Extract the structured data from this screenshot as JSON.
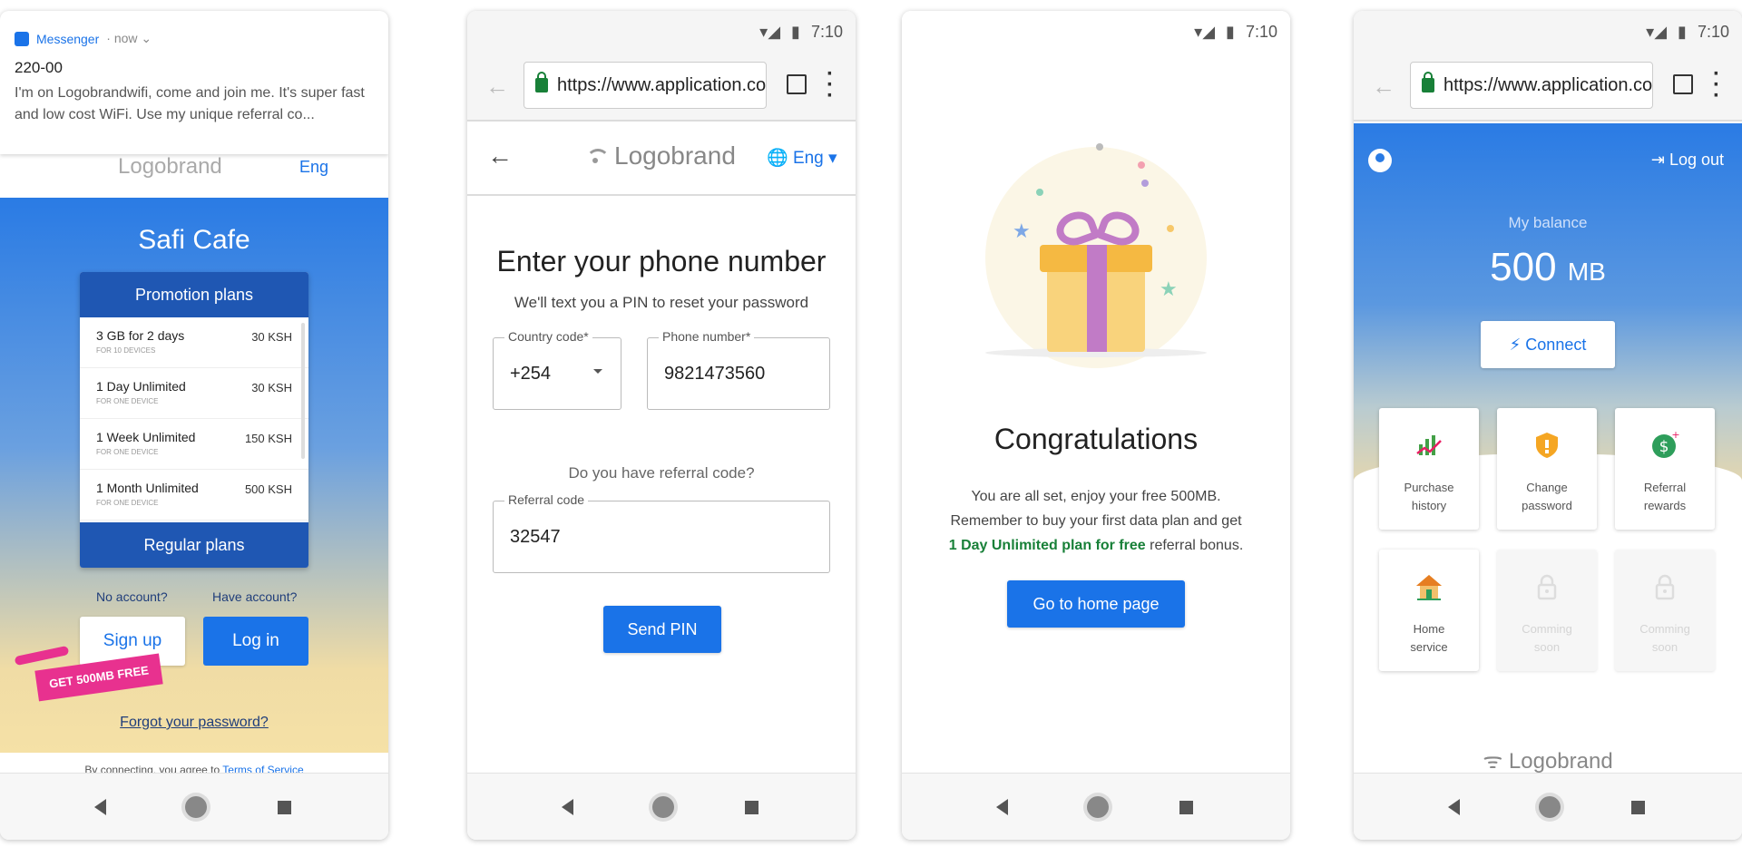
{
  "status": {
    "time": "7:10"
  },
  "browser": {
    "url": "https://www.application.co"
  },
  "nav": {
    "back": "◀",
    "home": "●",
    "recent": "■"
  },
  "phone1": {
    "notification": {
      "app": "Messenger",
      "meta": "· now ⌄",
      "sender": "220-00",
      "body": "I'm on Logobrandwifi, come and join me. It's super fast and low cost WiFi. Use my unique referral co..."
    },
    "header": {
      "logo": "Logobrand",
      "lang": "Eng"
    },
    "venue": "Safi Cafe",
    "promo_title": "Promotion plans",
    "plans": [
      {
        "name": "3 GB for 2 days",
        "sub": "FOR 10 DEVICES",
        "price": "30 KSH"
      },
      {
        "name": "1 Day Unlimited",
        "sub": "FOR ONE DEVICE",
        "price": "30 KSH"
      },
      {
        "name": "1 Week Unlimited",
        "sub": "FOR ONE DEVICE",
        "price": "150 KSH"
      },
      {
        "name": "1 Month Unlimited",
        "sub": "FOR ONE DEVICE",
        "price": "500 KSH"
      }
    ],
    "regular_title": "Regular plans",
    "no_account": "No account?",
    "have_account": "Have account?",
    "signup": "Sign up",
    "login": "Log in",
    "promo_badge": "GET 500MB FREE",
    "forgot": "Forgot your password?",
    "terms_prefix": "By connecting, you agree to",
    "terms_link": "Terms of Service"
  },
  "phone2": {
    "logo": "Logobrand",
    "lang": "Eng",
    "title": "Enter your phone number",
    "subtitle": "We'll text you a PIN to reset your password",
    "country_label": "Country code*",
    "country_value": "+254",
    "phone_label": "Phone number*",
    "phone_value": "9821473560",
    "referral_question": "Do you have referral code?",
    "referral_label": "Referral code",
    "referral_value": "32547",
    "send_pin": "Send PIN"
  },
  "phone3": {
    "title": "Congratulations",
    "line1": "You are all set, enjoy your free 500MB.",
    "line2": "Remember to buy your first data plan and get",
    "highlight": "1 Day Unlimited plan for free",
    "line3_suffix": "referral bonus.",
    "button": "Go to home page",
    "colors": {
      "green": "#188038"
    }
  },
  "phone4": {
    "logout": "Log out",
    "balance_label": "My balance",
    "balance_value": "500",
    "balance_unit": "MB",
    "connect": "Connect",
    "tiles": [
      {
        "line1": "Purchase",
        "line2": "history",
        "icon": "chart-icon"
      },
      {
        "line1": "Change",
        "line2": "password",
        "icon": "shield-icon"
      },
      {
        "line1": "Referral",
        "line2": "rewards",
        "icon": "dollar-icon"
      },
      {
        "line1": "Home",
        "line2": "service",
        "icon": "house-icon"
      },
      {
        "line1": "Comming",
        "line2": "soon",
        "icon": "lock-icon"
      },
      {
        "line1": "Comming",
        "line2": "soon",
        "icon": "lock-icon"
      }
    ],
    "footer_logo": "Logobrand"
  },
  "colors": {
    "brand_blue": "#1a73e8",
    "dark_blue": "#1f57b3",
    "pink": "#e8318f"
  }
}
